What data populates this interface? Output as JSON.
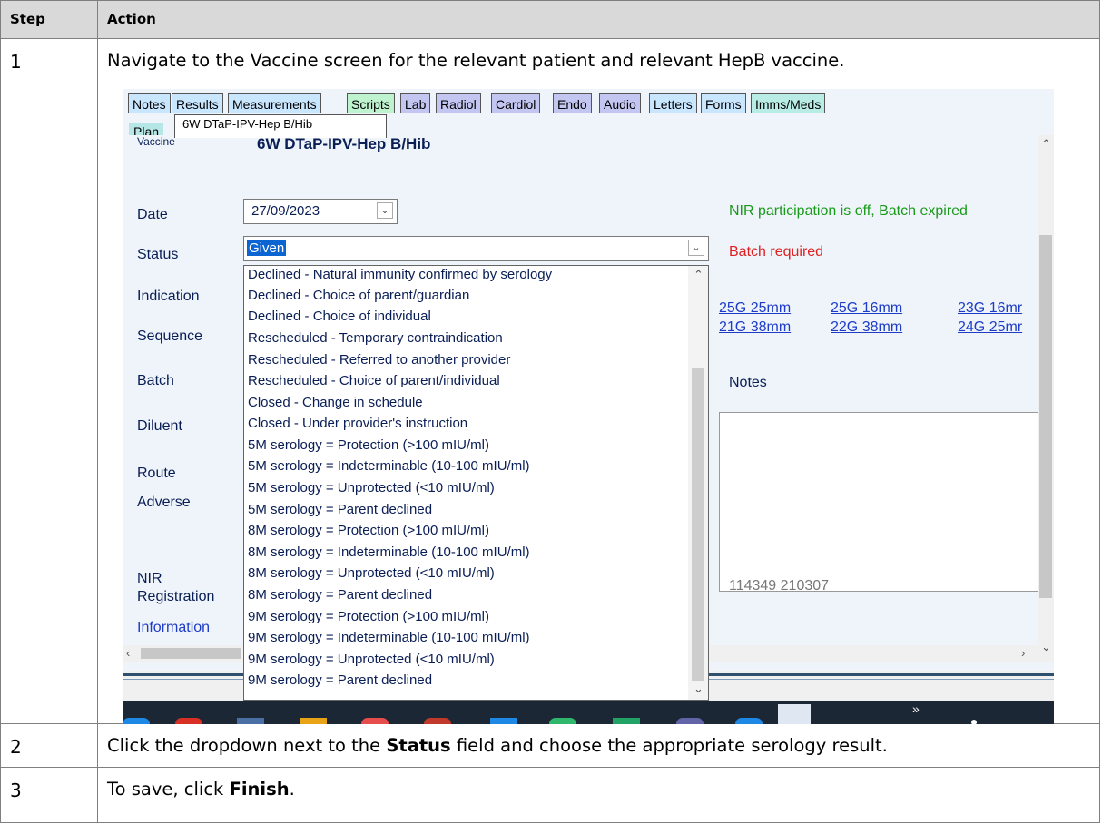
{
  "table": {
    "header_step": "Step",
    "header_action": "Action",
    "rows": [
      {
        "step": "1",
        "action": "Navigate to the Vaccine screen for the relevant patient and relevant HepB vaccine."
      },
      {
        "step": "2",
        "action_pre": "Click the dropdown next to the ",
        "action_bold": "Status",
        "action_post": " field and choose the appropriate serology result."
      },
      {
        "step": "3",
        "action_pre": "To save, click ",
        "action_bold": "Finish",
        "action_post": "."
      }
    ]
  },
  "screenshot": {
    "tabs": [
      "Notes",
      "Results",
      "Measurements",
      "Scripts",
      "Lab",
      "Radiol",
      "Cardiol",
      "Endo",
      "Audio",
      "Letters",
      "Forms",
      "Imms/Meds"
    ],
    "plan_tab": "Plan",
    "active_tab": "6W DTaP-IPV-Hep B/Hib",
    "vaccine_label": "Vaccine",
    "vaccine_name": "6W DTaP-IPV-Hep B/Hib",
    "labels": {
      "date": "Date",
      "status": "Status",
      "indication": "Indication",
      "sequence": "Sequence",
      "batch": "Batch",
      "diluent": "Diluent",
      "route": "Route",
      "adverse": "Adverse",
      "nir": "NIR",
      "registration": "Registration",
      "information": "Information",
      "notes": "Notes"
    },
    "date_value": "27/09/2023",
    "status_value": "Given",
    "nir_message": "NIR participation is off, Batch expired",
    "batch_required": "Batch required",
    "needles": [
      "25G 25mm",
      "25G 16mm",
      "23G 16mr",
      "21G 38mm",
      "22G 38mm",
      "24G 25mr"
    ],
    "id_numbers": "114349 210307",
    "dropdown_options": [
      "Declined - Natural immunity confirmed by serology",
      "Declined - Choice of parent/guardian",
      "Declined - Choice of individual",
      "Rescheduled - Temporary contraindication",
      "Rescheduled - Referred to another provider",
      "Rescheduled - Choice of parent/individual",
      "Closed - Change in schedule",
      "Closed - Under provider's instruction",
      "5M serology = Protection (>100 mIU/ml)",
      "5M serology = Indeterminable (10-100 mIU/ml)",
      "5M serology = Unprotected (<10 mIU/ml)",
      "5M serology = Parent declined",
      "8M serology = Protection (>100 mIU/ml)",
      "8M serology = Indeterminable (10-100 mIU/ml)",
      "8M serology = Unprotected (<10 mIU/ml)",
      "8M serology = Parent declined",
      "9M serology = Protection (>100 mIU/ml)",
      "9M serology = Indeterminable (10-100 mIU/ml)",
      "9M serology = Unprotected (<10 mIU/ml)",
      "9M serology = Parent declined"
    ],
    "taskbar_chevron": "»"
  }
}
